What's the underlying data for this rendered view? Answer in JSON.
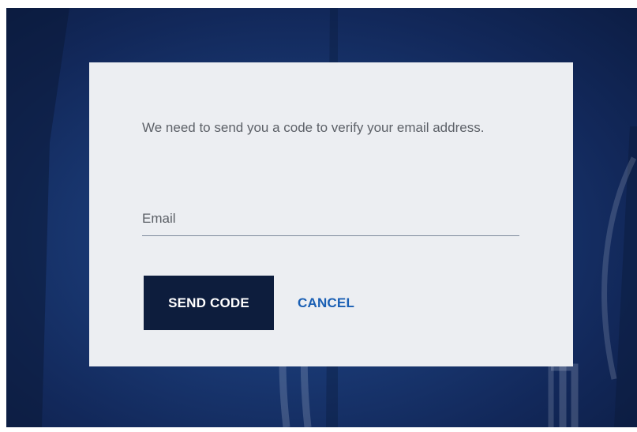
{
  "dialog": {
    "message": "We need to send you a code to verify your email address.",
    "email_field": {
      "value": "",
      "placeholder": "Email"
    },
    "send_label": "SEND CODE",
    "cancel_label": "CANCEL"
  },
  "colors": {
    "backdrop": "#1a3a75",
    "dialog_bg": "#eceef2",
    "send_button_bg": "#0d1d3d",
    "cancel_text": "#1a5fb4",
    "message_text": "#5d6168"
  }
}
